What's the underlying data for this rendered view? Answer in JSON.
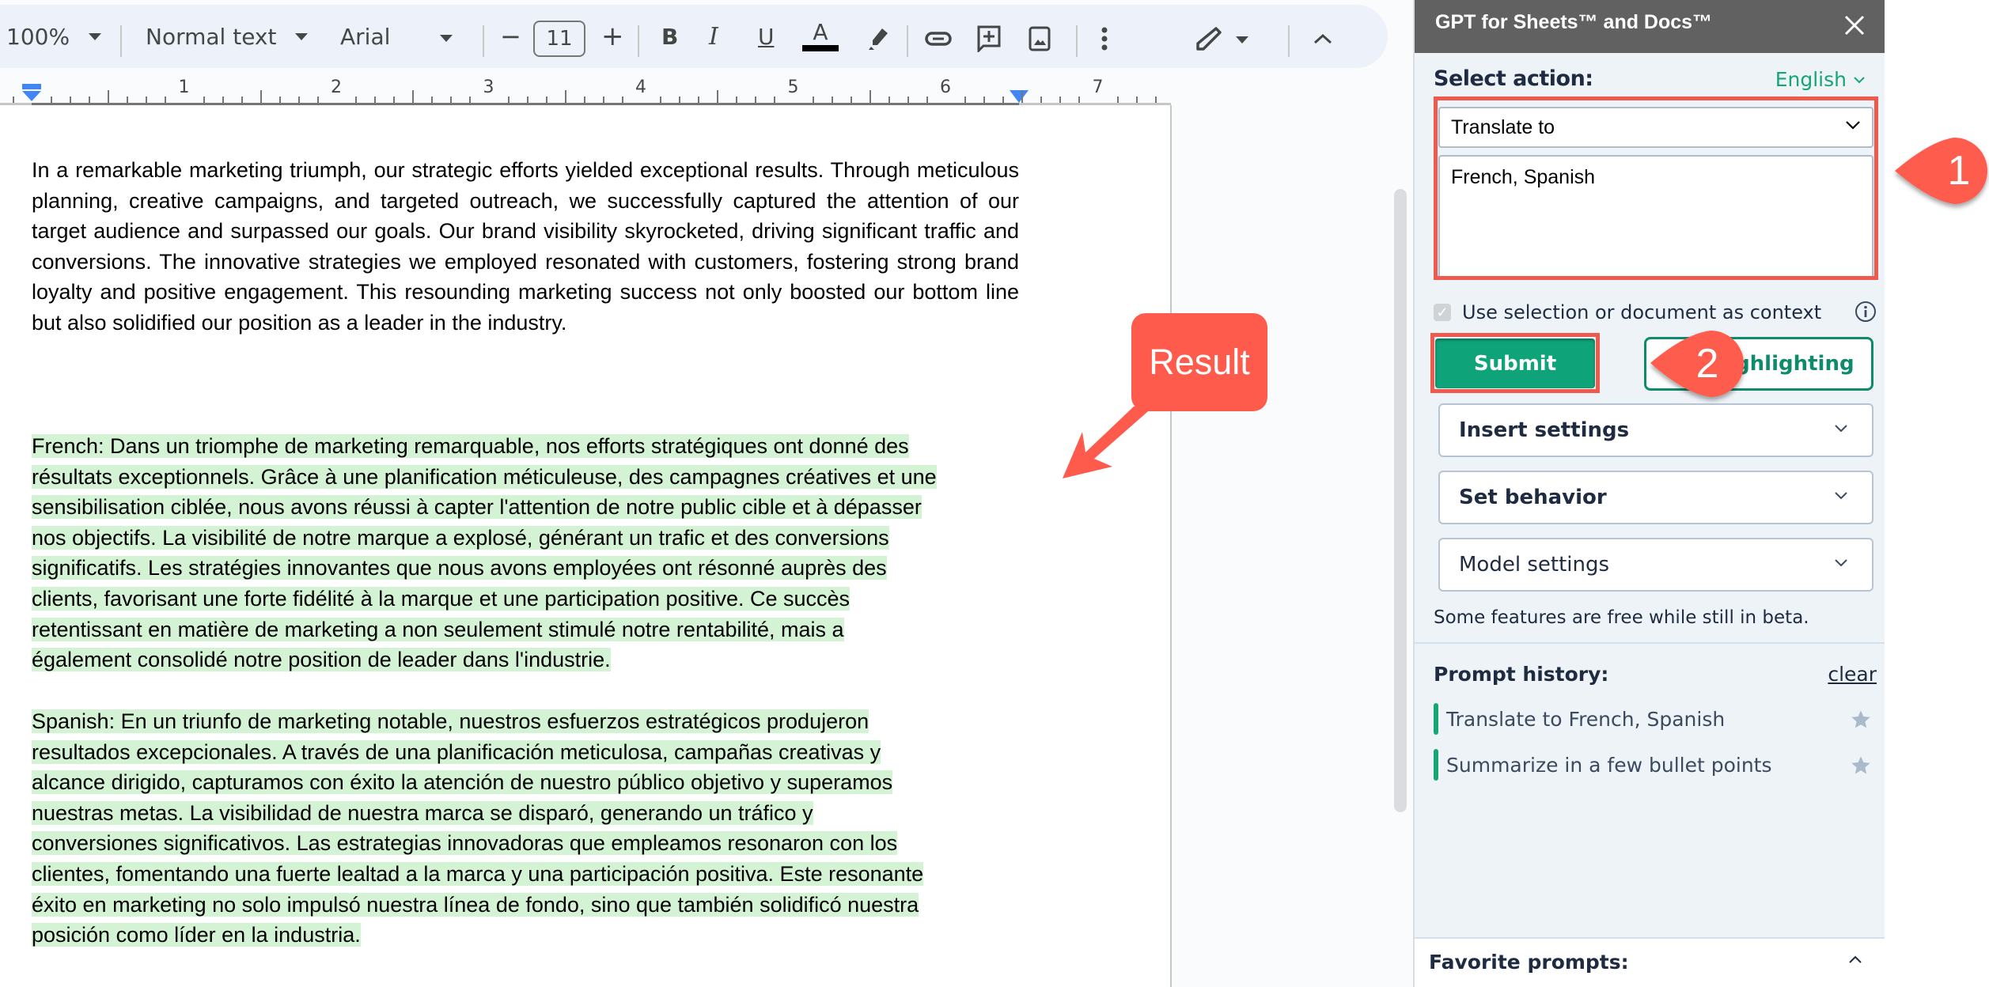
{
  "toolbar": {
    "zoom": "100%",
    "style": "Normal text",
    "font": "Arial",
    "font_size": "11",
    "decrease_label": "−",
    "increase_label": "+",
    "bold": "B",
    "italic": "I",
    "underline": "U",
    "text_color": "A",
    "text_color_value": "#000000"
  },
  "ruler": {
    "numbers": [
      "1",
      "2",
      "3",
      "4",
      "5",
      "6",
      "7"
    ]
  },
  "document": {
    "original": "In a remarkable marketing triumph, our strategic efforts yielded exceptional results. Through meticulous planning, creative campaigns, and targeted outreach, we successfully captured the attention of our target audience and surpassed our goals. Our brand visibility skyrocketed, driving significant traffic and conversions. The innovative strategies we employed resonated with customers, fostering strong brand loyalty and positive engagement. This resounding marketing success not only boosted our bottom line but also solidified our position as a leader in the industry.",
    "french_lines": [
      "French: Dans un triomphe de marketing remarquable, nos efforts stratégiques ont donné des",
      "résultats exceptionnels. Grâce à une planification méticuleuse, des campagnes créatives et une",
      "sensibilisation ciblée, nous avons réussi à capter l'attention de notre public cible et à dépasser",
      "nos objectifs. La visibilité de notre marque a explosé, générant un trafic et des conversions",
      "significatifs. Les stratégies innovantes que nous avons employées ont résonné auprès des",
      "clients, favorisant une forte fidélité à la marque et une participation positive. Ce succès",
      "retentissant en matière de marketing a non seulement stimulé notre rentabilité, mais a",
      "également consolidé notre position de leader dans l'industrie."
    ],
    "spanish_lines": [
      "Spanish: En un triunfo de marketing notable, nuestros esfuerzos estratégicos produjeron",
      "resultados excepcionales. A través de una planificación meticulosa, campañas creativas y",
      "alcance dirigido, capturamos con éxito la atención de nuestro público objetivo y superamos",
      "nuestras metas. La visibilidad de nuestra marca se disparó, generando un tráfico y",
      "conversiones significativos. Las estrategias innovadoras que empleamos resonaron con los",
      "clientes, fomentando una fuerte lealtad a la marca y una participación positiva. Este resonante",
      "éxito en marketing no solo impulsó nuestra línea de fondo, sino que también solidificó nuestra",
      "posición como líder en la industria."
    ],
    "highlight_color": "#d4f2d4"
  },
  "panel": {
    "title": "GPT for Sheets™ and Docs™",
    "select_action_label": "Select action:",
    "language": "English",
    "action_value": "Translate to",
    "prompt_value": "French, Spanish",
    "context_checkbox_label": "Use selection or document as context",
    "context_checked": true,
    "submit_label": "Submit",
    "highlighting_label": "Highlighting",
    "accordions": [
      "Insert settings",
      "Set behavior",
      "Model settings"
    ],
    "beta_note": "Some features are free while still in beta.",
    "prompt_history_label": "Prompt history:",
    "clear_label": "clear",
    "history": [
      "Translate to French, Spanish",
      "Summarize in a few bullet points"
    ],
    "favorite_prompts_label": "Favorite prompts:",
    "accent_color": "#0fa37a"
  },
  "annotations": {
    "result_label": "Result",
    "badge_1": "1",
    "badge_2": "2",
    "color": "#fe5b4d"
  }
}
